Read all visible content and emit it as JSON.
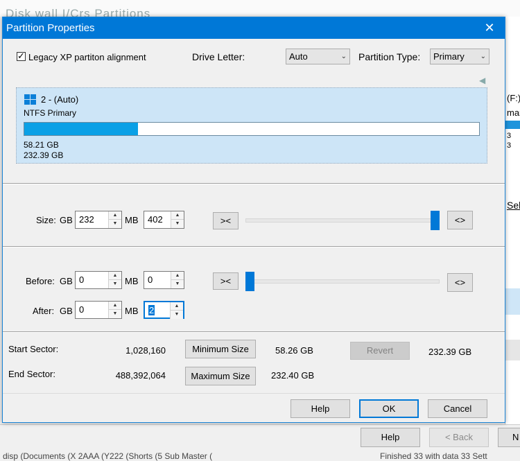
{
  "background": {
    "ghost_title": "Disk  wall  I/Crs  Partitions",
    "right_texts": [
      "(F:)",
      "mary",
      "3",
      "3",
      "Sel"
    ],
    "bottom_buttons": {
      "help": "Help",
      "back": "< Back",
      "next": "N"
    },
    "footer_left": "disp (Documents (X 2AAA (Y222 (Shorts (5 Sub Master (",
    "footer_right": "Finished 33 with data 33 Sett"
  },
  "dialog": {
    "title": "Partition Properties",
    "close_glyph": "✕",
    "legacy_checkbox": {
      "label": "Legacy XP partiton alignment",
      "checked": true,
      "check_glyph": "✓"
    },
    "drive_letter": {
      "label": "Drive Letter:",
      "value": "Auto"
    },
    "partition_type": {
      "label": "Partition Type:",
      "value": "Primary"
    },
    "disk": {
      "name": "2 -  (Auto)",
      "fs": "NTFS Primary",
      "used": "58.21 GB",
      "total": "232.39 GB",
      "used_fraction": 0.25
    },
    "size": {
      "label": "Size:",
      "gb_label": "GB",
      "gb": "232",
      "mb_label": "MB",
      "mb": "402",
      "shrink": "><",
      "expand": "<>",
      "slider_fraction": 1.0
    },
    "before": {
      "label": "Before:",
      "gb_label": "GB",
      "gb": "0",
      "mb_label": "MB",
      "mb": "0",
      "shrink": "><",
      "expand": "<>",
      "slider_fraction": 0.0
    },
    "after": {
      "label": "After:",
      "gb_label": "GB",
      "gb": "0",
      "mb_label": "MB",
      "mb": "2"
    },
    "start_sector": {
      "label": "Start Sector:",
      "value": "1,028,160"
    },
    "end_sector": {
      "label": "End Sector:",
      "value": "488,392,064"
    },
    "minimum_size": {
      "button": "Minimum Size",
      "value": "58.26 GB"
    },
    "maximum_size": {
      "button": "Maximum Size",
      "value": "232.40 GB"
    },
    "revert": {
      "button": "Revert",
      "value": "232.39 GB"
    },
    "footer": {
      "help": "Help",
      "ok": "OK",
      "cancel": "Cancel"
    },
    "colors": {
      "titlebar": "#0078d7",
      "accent": "#0078d7",
      "usage_fill": "#0aa0e6",
      "panel": "#cde5f7"
    }
  }
}
